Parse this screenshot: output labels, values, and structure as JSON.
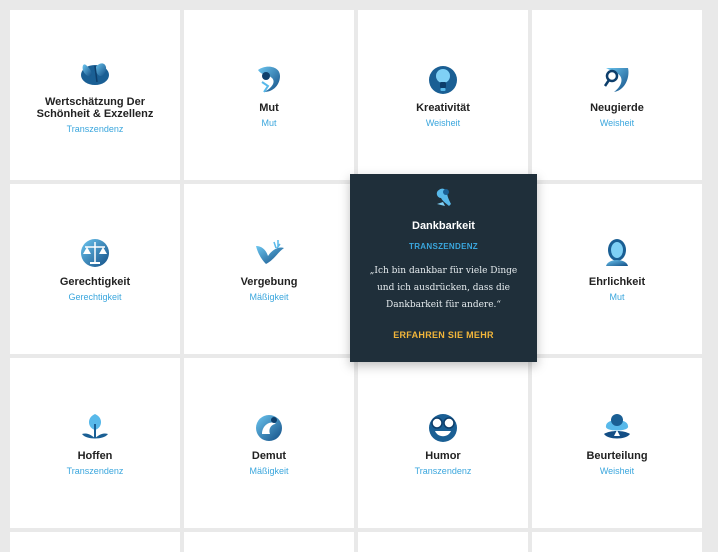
{
  "cards": [
    {
      "name": "Wertschätzung Der Schönheit & Exzellenz",
      "category": "Transzendenz",
      "icon": "butterfly-icon"
    },
    {
      "name": "Mut",
      "category": "Mut",
      "icon": "courage-icon"
    },
    {
      "name": "Kreativität",
      "category": "Weisheit",
      "icon": "lightbulb-icon"
    },
    {
      "name": "Neugierde",
      "category": "Weisheit",
      "icon": "magnifier-icon"
    },
    {
      "name": "Gerechtigkeit",
      "category": "Gerechtigkeit",
      "icon": "scales-icon"
    },
    {
      "name": "Vergebung",
      "category": "Mäßigkeit",
      "icon": "dove-icon"
    },
    {
      "name": "Ehrlichkeit",
      "category": "Mut",
      "icon": "mirror-icon"
    },
    {
      "name": "Hoffen",
      "category": "Transzendenz",
      "icon": "sprout-icon"
    },
    {
      "name": "Demut",
      "category": "Mäßigkeit",
      "icon": "humility-icon"
    },
    {
      "name": "Humor",
      "category": "Transzendenz",
      "icon": "laughing-face-icon"
    },
    {
      "name": "Beurteilung",
      "category": "Weisheit",
      "icon": "judgement-icon"
    }
  ],
  "featured": {
    "title": "Dankbarkeit",
    "category": "TRANSZENDENZ",
    "quote": "„Ich bin dankbar für viele Dinge und ich ausdrücken, dass die Dankbarkeit für andere.“",
    "cta": "ERFAHREN SIE MEHR",
    "icon": "gratitude-icon"
  },
  "colors": {
    "accent": "#3aa6dd",
    "featured_bg": "#1f2f3a",
    "cta": "#f2b63a",
    "icon_dark": "#1a5f94",
    "icon_light": "#58b9ea"
  }
}
